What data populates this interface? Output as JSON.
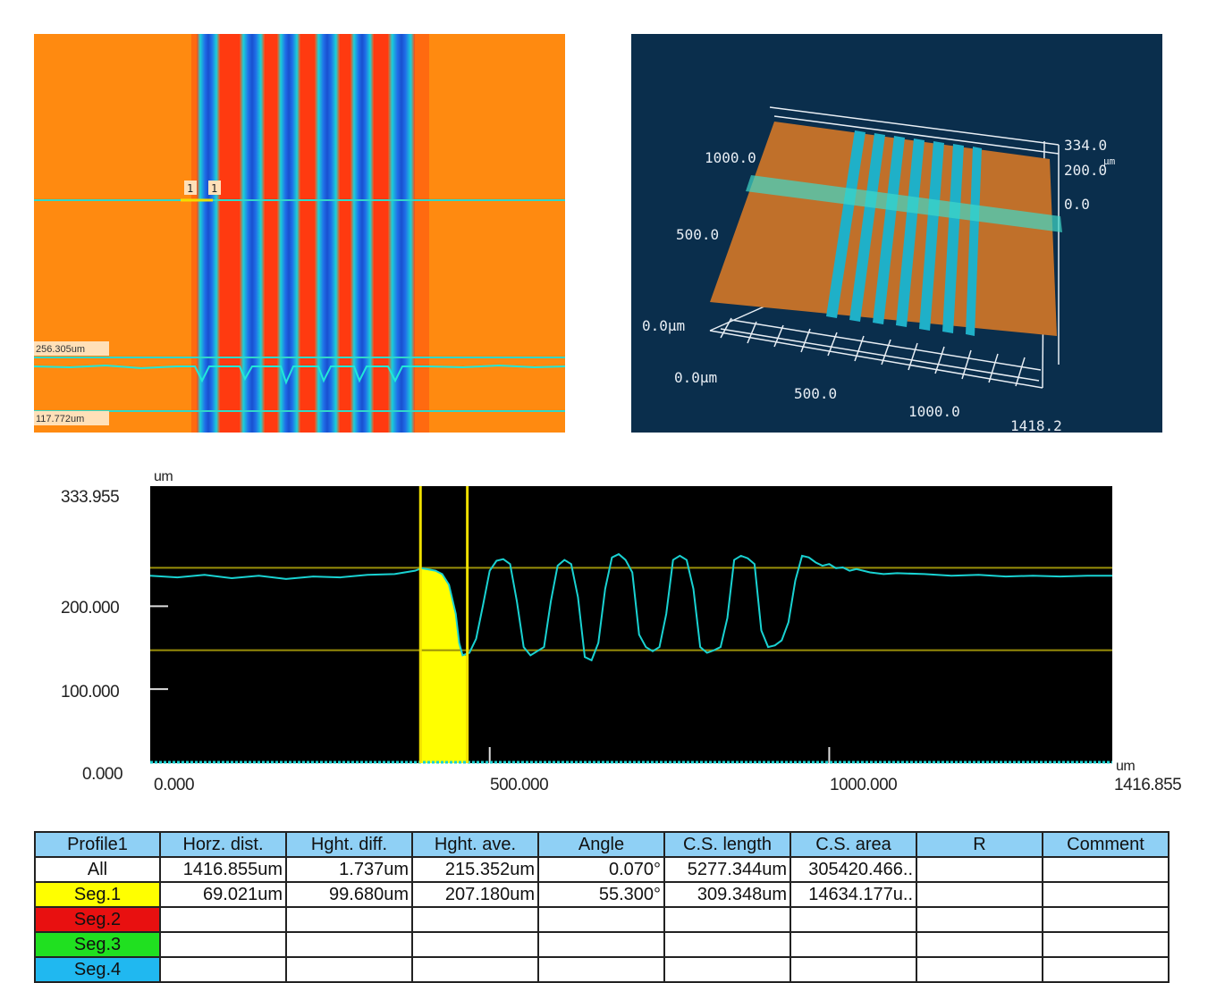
{
  "height_map": {
    "cursor_marker_1": "1",
    "cursor_marker_2": "1",
    "upper_line_label": "256.305um",
    "lower_line_label": "117.772um"
  },
  "view_3d": {
    "y_ticks": [
      "1000.0",
      "500.0",
      "0.0µm"
    ],
    "x_ticks": [
      "0.0µm",
      "500.0",
      "1000.0",
      "1418.2"
    ],
    "z_ticks": [
      "334.0",
      "200.0",
      "0.0"
    ],
    "z_unit": "µm"
  },
  "chart_data": {
    "type": "line",
    "y_unit": "um",
    "x_unit": "um",
    "y_ticks": [
      "333.955",
      "200.000",
      "100.000",
      "0.000"
    ],
    "x_ticks": [
      "0.000",
      "500.000",
      "1000.000",
      "1416.855"
    ],
    "xlim": [
      0,
      1416.855
    ],
    "ylim": [
      0,
      333.955
    ],
    "reference_lines_y": [
      235.5,
      136.2
    ],
    "cursors_x": [
      398,
      467
    ],
    "segment_1_fill_x": [
      398,
      467
    ],
    "grid": false,
    "colors": {
      "background": "#000000",
      "profile": "#19d2d2",
      "cursor": "#f0e000",
      "segment_fill": "#ffff00",
      "reference": "#9a8f0a"
    },
    "series": [
      {
        "x": [
          0,
          40,
          80,
          120,
          160,
          200,
          240,
          280,
          320,
          360,
          390,
          400,
          420,
          430,
          440,
          450,
          455,
          460,
          470,
          480,
          490,
          500,
          510,
          520,
          530,
          540,
          550,
          560,
          570,
          580,
          590,
          600,
          610,
          620,
          630,
          640,
          650,
          660,
          670,
          680,
          690,
          700,
          710,
          720,
          730,
          740,
          750,
          760,
          770,
          780,
          790,
          800,
          810,
          820,
          830,
          840,
          850,
          860,
          870,
          880,
          890,
          900,
          910,
          920,
          930,
          940,
          950,
          960,
          970,
          980,
          990,
          1000,
          1010,
          1020,
          1030,
          1040,
          1060,
          1080,
          1100,
          1140,
          1180,
          1220,
          1260,
          1300,
          1340,
          1380,
          1416.855
        ],
        "y": [
          226,
          224,
          227,
          223,
          226,
          222,
          225,
          224,
          227,
          228,
          232,
          235,
          232,
          228,
          215,
          180,
          145,
          130,
          133,
          150,
          190,
          232,
          244,
          246,
          240,
          195,
          140,
          130,
          135,
          140,
          195,
          238,
          245,
          240,
          200,
          128,
          124,
          145,
          210,
          248,
          252,
          245,
          230,
          155,
          140,
          135,
          140,
          180,
          245,
          250,
          245,
          210,
          140,
          133,
          136,
          140,
          175,
          245,
          250,
          247,
          240,
          160,
          140,
          142,
          148,
          170,
          220,
          250,
          248,
          242,
          238,
          240,
          235,
          236,
          232,
          234,
          230,
          228,
          229,
          228,
          226,
          227,
          225,
          226,
          225,
          226,
          226
        ]
      }
    ]
  },
  "table": {
    "columns": [
      "Profile1",
      "Horz. dist.",
      "Hght. diff.",
      "Hght. ave.",
      "Angle",
      "C.S. length",
      "C.S. area",
      "R",
      "Comment"
    ],
    "rows": [
      {
        "label": "All",
        "color": "#ffffff",
        "cells": [
          "1416.855um",
          "1.737um",
          "215.352um",
          "0.070°",
          "5277.344um",
          "305420.466..",
          "",
          ""
        ]
      },
      {
        "label": "Seg.1",
        "color": "#ffff00",
        "cells": [
          "69.021um",
          "99.680um",
          "207.180um",
          "55.300°",
          "309.348um",
          "14634.177u..",
          "",
          ""
        ]
      },
      {
        "label": "Seg.2",
        "color": "#e81010",
        "cells": [
          "",
          "",
          "",
          "",
          "",
          "",
          "",
          ""
        ]
      },
      {
        "label": "Seg.3",
        "color": "#20e020",
        "cells": [
          "",
          "",
          "",
          "",
          "",
          "",
          "",
          ""
        ]
      },
      {
        "label": "Seg.4",
        "color": "#20b8f0",
        "cells": [
          "",
          "",
          "",
          "",
          "",
          "",
          "",
          ""
        ]
      }
    ]
  }
}
